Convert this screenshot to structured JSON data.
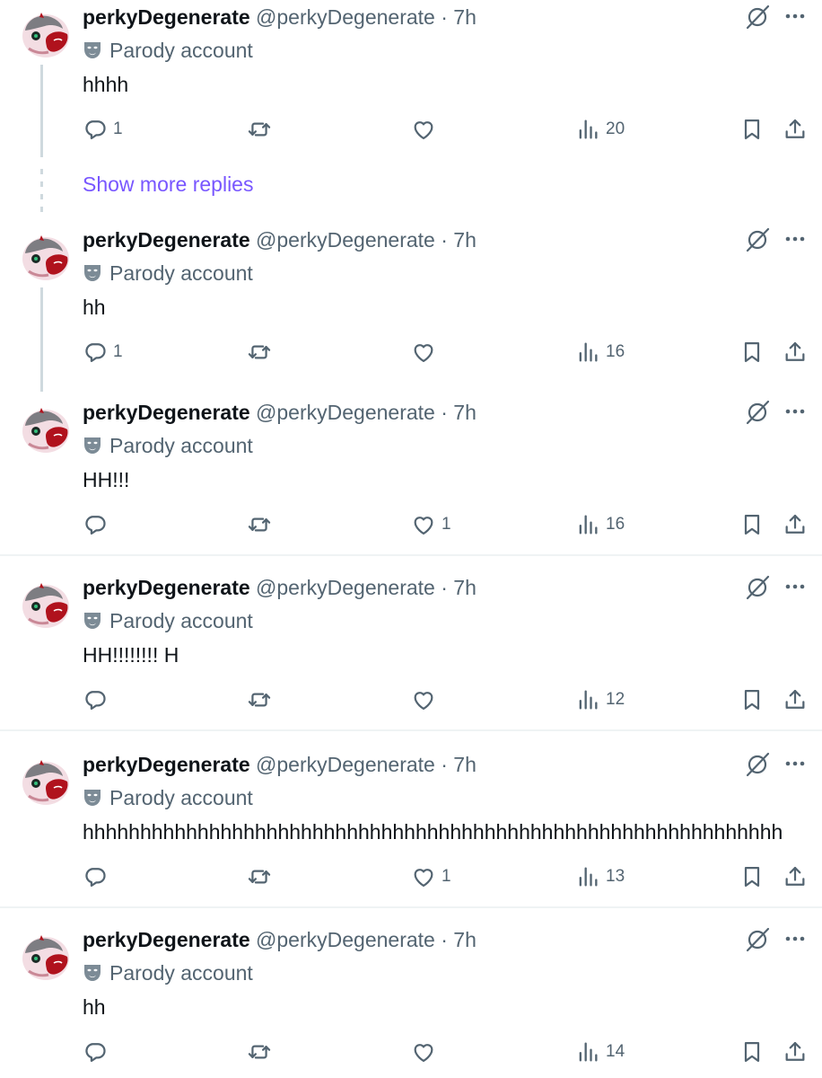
{
  "colors": {
    "text": "#0f1419",
    "muted": "#536471",
    "link": "#7856ff",
    "divider": "#eff3f4",
    "thread_line": "#cfd9de"
  },
  "icons": {
    "reply": "reply-icon",
    "repost": "repost-icon",
    "like": "like-icon",
    "views": "views-icon",
    "bookmark": "bookmark-icon",
    "share": "share-icon",
    "grok": "grok-icon",
    "more": "more-icon",
    "parody": "parody-mask-icon"
  },
  "show_more_label": "Show more replies",
  "tweets": [
    {
      "name": "perkyDegenerate",
      "handle": "@perkyDegenerate",
      "separator": "·",
      "time": "7h",
      "badge": "Parody account",
      "text": "hhhh",
      "replies": "1",
      "reposts": "",
      "likes": "",
      "views": "20"
    },
    {
      "name": "perkyDegenerate",
      "handle": "@perkyDegenerate",
      "separator": "·",
      "time": "7h",
      "badge": "Parody account",
      "text": "hh",
      "replies": "1",
      "reposts": "",
      "likes": "",
      "views": "16"
    },
    {
      "name": "perkyDegenerate",
      "handle": "@perkyDegenerate",
      "separator": "·",
      "time": "7h",
      "badge": "Parody account",
      "text": "HH!!!",
      "replies": "",
      "reposts": "",
      "likes": "1",
      "views": "16"
    },
    {
      "name": "perkyDegenerate",
      "handle": "@perkyDegenerate",
      "separator": "·",
      "time": "7h",
      "badge": "Parody account",
      "text": "HH!!!!!!!! H",
      "replies": "",
      "reposts": "",
      "likes": "",
      "views": "12"
    },
    {
      "name": "perkyDegenerate",
      "handle": "@perkyDegenerate",
      "separator": "·",
      "time": "7h",
      "badge": "Parody account",
      "text": "hhhhhhhhhhhhhhhhhhhhhhhhhhhhhhhhhhhhhhhhhhhhhhhhhhhhhhhhhhhhh",
      "replies": "",
      "reposts": "",
      "likes": "1",
      "views": "13"
    },
    {
      "name": "perkyDegenerate",
      "handle": "@perkyDegenerate",
      "separator": "·",
      "time": "7h",
      "badge": "Parody account",
      "text": "hh",
      "replies": "",
      "reposts": "",
      "likes": "",
      "views": "14"
    }
  ]
}
